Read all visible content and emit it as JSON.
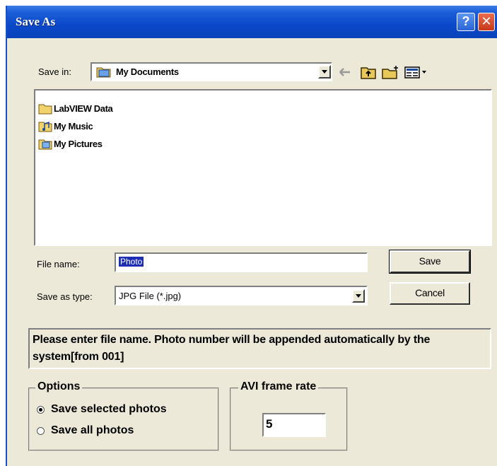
{
  "window": {
    "title": "Save As",
    "help_label": "?",
    "close_label": "✕"
  },
  "save_in": {
    "label": "Save in:",
    "value": "My Documents",
    "folder_icon": "folder-documents-icon",
    "tools": [
      "back-arrow-icon",
      "up-folder-icon",
      "new-folder-icon",
      "view-menu-icon"
    ]
  },
  "files": [
    {
      "name": "LabVIEW Data",
      "icon": "folder-icon"
    },
    {
      "name": "My Music",
      "icon": "music-folder-icon"
    },
    {
      "name": "My Pictures",
      "icon": "pictures-folder-icon"
    }
  ],
  "file_name": {
    "label": "File name:",
    "value": "Photo"
  },
  "save_as_type": {
    "label": "Save as type:",
    "value": "JPG File (*.jpg)"
  },
  "buttons": {
    "save": "Save",
    "cancel": "Cancel"
  },
  "message": "Please enter file name. Photo number will be appended automatically by the system[from 001]",
  "options": {
    "title": "Options",
    "choices": [
      {
        "label": "Save selected photos",
        "selected": true
      },
      {
        "label": "Save all photos",
        "selected": false
      }
    ]
  },
  "avi": {
    "title": "AVI frame rate",
    "value": "5"
  },
  "colors": {
    "titlebar": "#0a48c9",
    "dialog_bg": "#ece9d8",
    "selection": "#1e2eb4",
    "close_button": "#c8391b"
  }
}
